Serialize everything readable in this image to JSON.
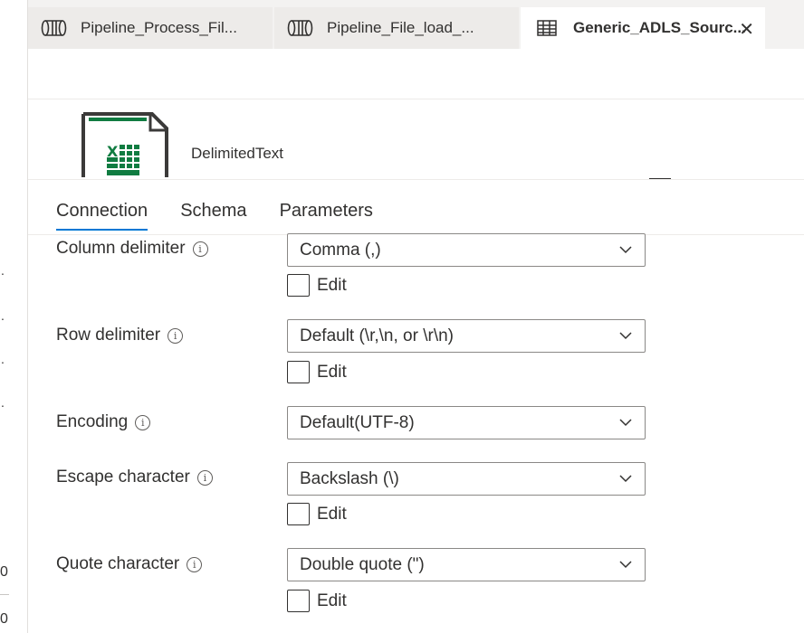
{
  "tabs": [
    {
      "label": "Pipeline_Process_Fil...",
      "icon": "pipeline-icon"
    },
    {
      "label": "Pipeline_File_load_...",
      "icon": "pipeline-icon"
    },
    {
      "label": "Generic_ADLS_Sourc...",
      "icon": "table-icon",
      "active": true
    }
  ],
  "dataset": {
    "type_label": "DelimitedText",
    "icon": "excel-file-icon"
  },
  "left_strip": {
    "dots": [
      ".",
      ".",
      ".",
      "."
    ],
    "zeros": [
      "0",
      "0"
    ]
  },
  "property_tabs": [
    "Connection",
    "Schema",
    "Parameters"
  ],
  "fields": {
    "column_delimiter": {
      "label": "Column delimiter",
      "value": "Comma (,)",
      "edit_label": "Edit"
    },
    "row_delimiter": {
      "label": "Row delimiter",
      "value": "Default (\\r,\\n, or \\r\\n)",
      "edit_label": "Edit"
    },
    "encoding": {
      "label": "Encoding",
      "value": "Default(UTF-8)"
    },
    "escape_character": {
      "label": "Escape character",
      "value": "Backslash (\\)",
      "edit_label": "Edit"
    },
    "quote_character": {
      "label": "Quote character",
      "value": "Double quote (\")",
      "edit_label": "Edit"
    }
  },
  "colors": {
    "accent": "#0078d4",
    "excel_green": "#107c41",
    "icon_dark": "#3b3a39"
  }
}
